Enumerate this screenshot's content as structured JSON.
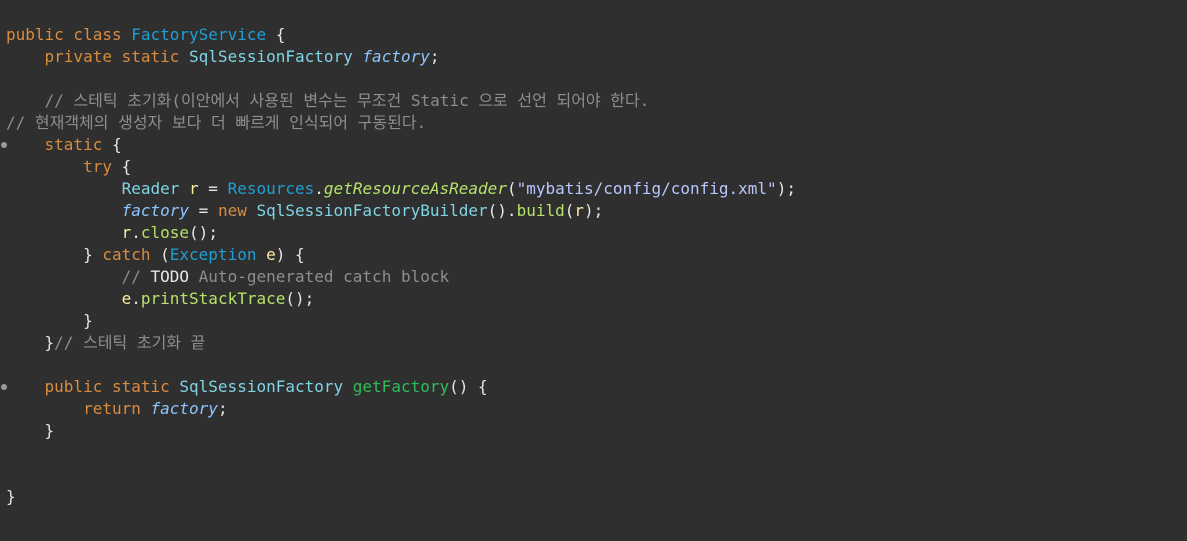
{
  "code_lines": [
    [
      {
        "t": "public class ",
        "c": "tok-kw"
      },
      {
        "t": "FactoryService",
        "c": "tok-cls"
      },
      {
        "t": " {",
        "c": "tok-pun"
      }
    ],
    [
      {
        "t": "    private static ",
        "c": "tok-kw"
      },
      {
        "t": "SqlSessionFactory ",
        "c": "tok-type"
      },
      {
        "t": "factory",
        "c": "tok-field"
      },
      {
        "t": ";",
        "c": "tok-pun"
      }
    ],
    [],
    [
      {
        "t": "    // 스테틱 초기화(이안에서 사용된 변수는 무조건 Static 으로 선언 되어야 한다.",
        "c": "tok-cmt"
      }
    ],
    [
      {
        "t": "// 현재객체의 생성자 보다 더 빠르게 인식되어 구동된다.",
        "c": "tok-cmt"
      }
    ],
    [
      {
        "t": "    static ",
        "c": "tok-kw"
      },
      {
        "t": "{",
        "c": "tok-pun"
      }
    ],
    [
      {
        "t": "        try ",
        "c": "tok-kw"
      },
      {
        "t": "{",
        "c": "tok-pun"
      }
    ],
    [
      {
        "t": "            ",
        "c": "tok-pun"
      },
      {
        "t": "Reader ",
        "c": "tok-type"
      },
      {
        "t": "r",
        "c": "tok-var"
      },
      {
        "t": " = ",
        "c": "tok-pun"
      },
      {
        "t": "Resources",
        "c": "tok-cls"
      },
      {
        "t": ".",
        "c": "tok-pun"
      },
      {
        "t": "getResourceAsReader",
        "c": "tok-call"
      },
      {
        "t": "(",
        "c": "tok-pun"
      },
      {
        "t": "\"mybatis/config/config.xml\"",
        "c": "tok-str"
      },
      {
        "t": ");",
        "c": "tok-pun"
      }
    ],
    [
      {
        "t": "            ",
        "c": "tok-pun"
      },
      {
        "t": "factory",
        "c": "tok-field"
      },
      {
        "t": " = ",
        "c": "tok-pun"
      },
      {
        "t": "new ",
        "c": "tok-kw"
      },
      {
        "t": "SqlSessionFactoryBuilder",
        "c": "tok-type"
      },
      {
        "t": "().",
        "c": "tok-pun"
      },
      {
        "t": "build",
        "c": "tok-meth"
      },
      {
        "t": "(",
        "c": "tok-pun"
      },
      {
        "t": "r",
        "c": "tok-var"
      },
      {
        "t": ");",
        "c": "tok-pun"
      }
    ],
    [
      {
        "t": "            ",
        "c": "tok-pun"
      },
      {
        "t": "r",
        "c": "tok-var"
      },
      {
        "t": ".",
        "c": "tok-pun"
      },
      {
        "t": "close",
        "c": "tok-meth"
      },
      {
        "t": "();",
        "c": "tok-pun"
      }
    ],
    [
      {
        "t": "        } ",
        "c": "tok-pun"
      },
      {
        "t": "catch ",
        "c": "tok-kw"
      },
      {
        "t": "(",
        "c": "tok-pun"
      },
      {
        "t": "Exception ",
        "c": "tok-cls"
      },
      {
        "t": "e",
        "c": "tok-var"
      },
      {
        "t": ") {",
        "c": "tok-pun"
      }
    ],
    [
      {
        "t": "            // ",
        "c": "tok-cmt"
      },
      {
        "t": "TODO",
        "c": "tok-pun"
      },
      {
        "t": " Auto-generated catch block",
        "c": "tok-cmt"
      }
    ],
    [
      {
        "t": "            ",
        "c": "tok-pun"
      },
      {
        "t": "e",
        "c": "tok-var"
      },
      {
        "t": ".",
        "c": "tok-pun"
      },
      {
        "t": "printStackTrace",
        "c": "tok-meth"
      },
      {
        "t": "();",
        "c": "tok-pun"
      }
    ],
    [
      {
        "t": "        }",
        "c": "tok-pun"
      }
    ],
    [
      {
        "t": "    }",
        "c": "tok-pun"
      },
      {
        "t": "// 스테틱 초기화 끝",
        "c": "tok-cmt"
      }
    ],
    [],
    [
      {
        "t": "    public static ",
        "c": "tok-kw"
      },
      {
        "t": "SqlSessionFactory ",
        "c": "tok-type"
      },
      {
        "t": "getFactory",
        "c": "tok-mdef"
      },
      {
        "t": "() {",
        "c": "tok-pun"
      }
    ],
    [
      {
        "t": "        return ",
        "c": "tok-kw"
      },
      {
        "t": "factory",
        "c": "tok-field"
      },
      {
        "t": ";",
        "c": "tok-pun"
      }
    ],
    [
      {
        "t": "    }",
        "c": "tok-pun"
      }
    ],
    [],
    [],
    [
      {
        "t": "}",
        "c": "tok-pun"
      }
    ]
  ],
  "markers": [
    5,
    16
  ],
  "colors": {
    "background": "#2f2f2f",
    "keyword": "#d98c3f",
    "class": "#1e9fd6",
    "type": "#7fd4e6",
    "field": "#8ec5ff",
    "string": "#b8c7ff",
    "comment": "#8e8e8e",
    "method_def": "#2dbd5c"
  }
}
